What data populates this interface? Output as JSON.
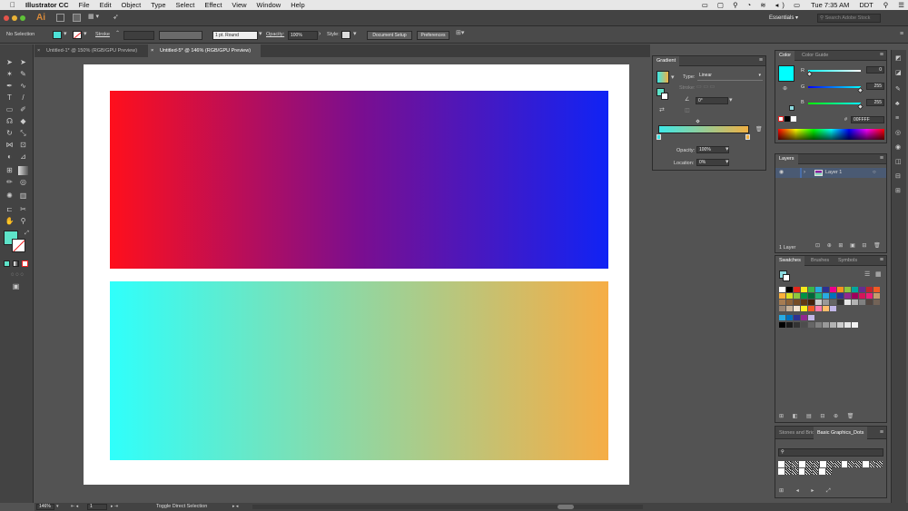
{
  "mac_menu": {
    "apple": "",
    "app_name": "Illustrator CC",
    "items": [
      "File",
      "Edit",
      "Object",
      "Type",
      "Select",
      "Effect",
      "View",
      "Window",
      "Help"
    ],
    "time": "Tue 7:35 AM",
    "user": "DDT"
  },
  "appbar": {
    "logo": "Ai",
    "workspace": "Essentials",
    "search_placeholder": "Search Adobe Stock"
  },
  "control_bar": {
    "selection": "No Selection",
    "stroke_label": "Stroke",
    "stroke_profile": "1 pt. Round",
    "opacity_label": "Opacity:",
    "opacity_value": "100%",
    "style_label": "Style:",
    "doc_setup": "Document Setup",
    "preferences": "Preferences"
  },
  "tabs": [
    {
      "label": "Untitled-1* @ 150% (RGB/GPU Preview)"
    },
    {
      "label": "Untitled-5* @ 146% (RGB/GPU Preview)"
    }
  ],
  "status_bar": {
    "zoom": "146%",
    "page": "1",
    "tool": "Toggle Direct Selection"
  },
  "gradient_panel": {
    "title": "Gradient",
    "type_label": "Type:",
    "type_value": "Linear",
    "stroke_label": "Stroke:",
    "angle_value": "0°",
    "opacity_label": "Opacity:",
    "opacity_value": "100%",
    "location_label": "Location:",
    "location_value": "0%"
  },
  "color_panel": {
    "tab_color": "Color",
    "tab_guide": "Color Guide",
    "r_label": "R",
    "r_value": "0",
    "g_label": "G",
    "g_value": "255",
    "b_label": "B",
    "b_value": "255",
    "hex_prefix": "#",
    "hex_value": "00FFFF"
  },
  "layers_panel": {
    "title": "Layers",
    "layer_name": "Layer 1",
    "count": "1 Layer"
  },
  "swatches_panel": {
    "tabs": [
      "Swatches",
      "Brushes",
      "Symbols"
    ]
  },
  "stones_panel": {
    "tabs": [
      "Stones and Bric",
      "Basic Graphics_Dots"
    ]
  },
  "canvas": {
    "gradient_top": {
      "start": "#ff0f1c",
      "mid": "#7b0e8f",
      "end": "#1023f5"
    },
    "gradient_bottom": {
      "start": "#2ffffb",
      "end": "#f6ad45"
    }
  },
  "colors": {
    "accent": "#00ffff",
    "gradient_bar_start": "#3ee8e8",
    "gradient_bar_end": "#f0b043",
    "layer_color": "#4a6ea8"
  }
}
